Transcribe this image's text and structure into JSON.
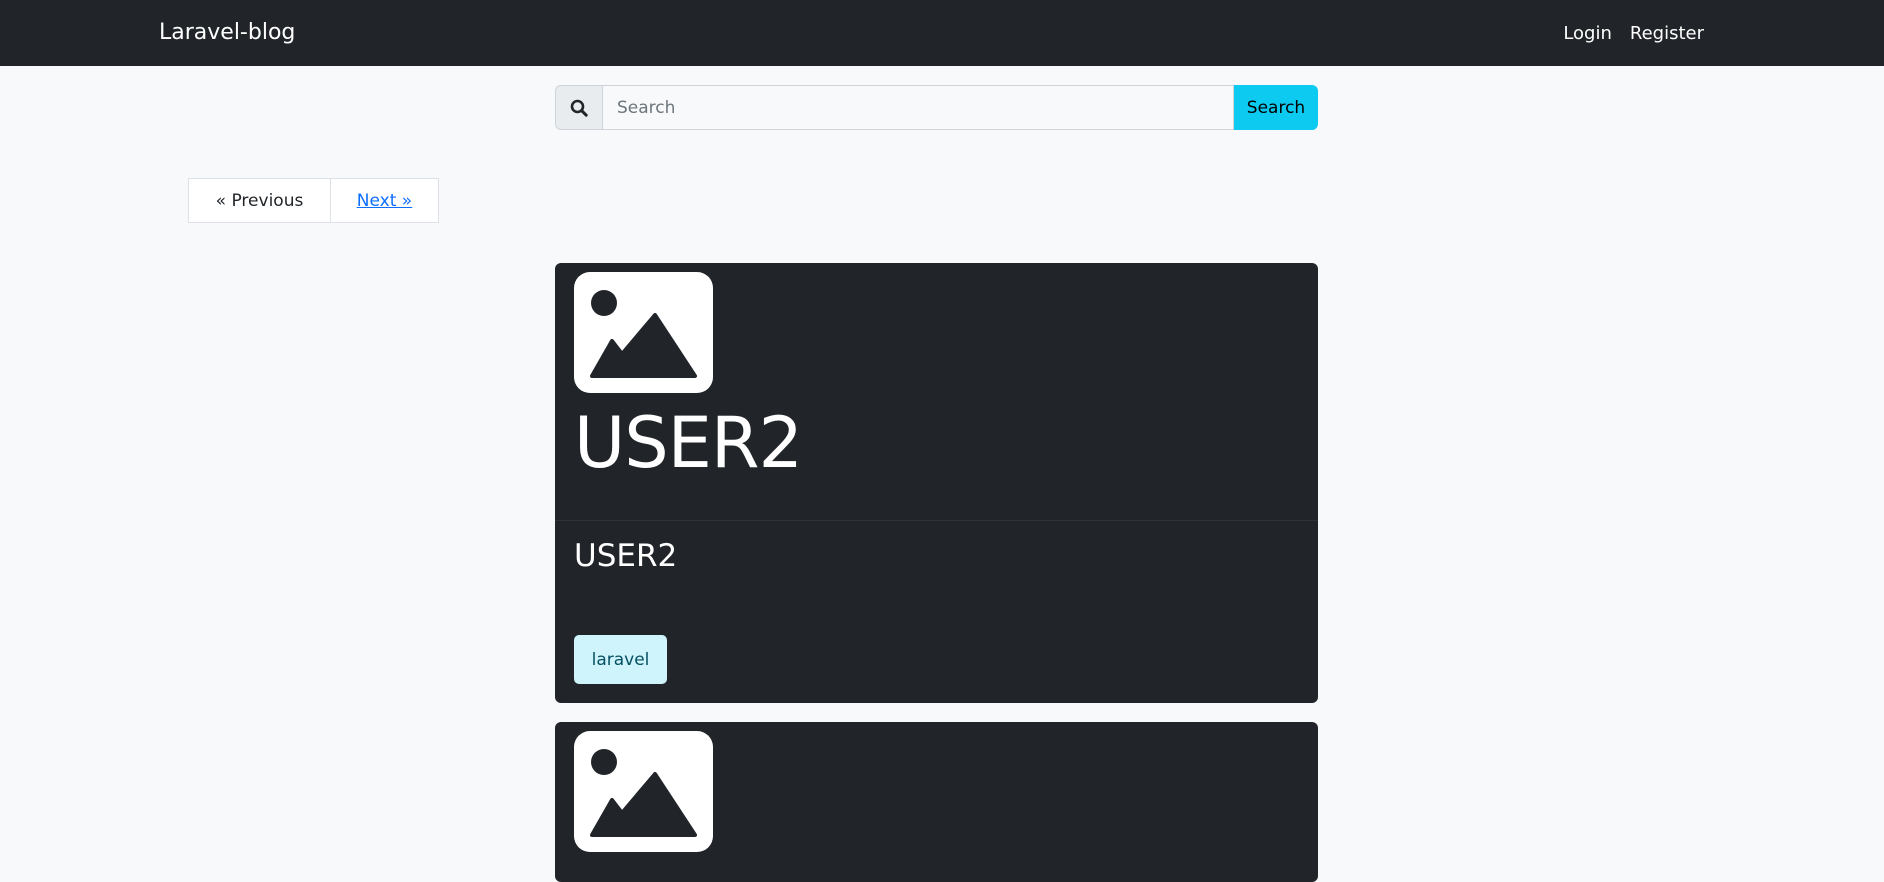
{
  "navbar": {
    "brand": "Laravel-blog",
    "links": [
      {
        "label": "Login"
      },
      {
        "label": "Register"
      }
    ]
  },
  "search": {
    "placeholder": "Search",
    "value": "",
    "button_label": "Search",
    "icon": "search-icon"
  },
  "pagination": {
    "previous_label": "« Previous",
    "next_label": "Next »"
  },
  "posts": [
    {
      "image_icon": "image-placeholder-icon",
      "title": "USER2",
      "subtitle": "USER2",
      "tag": "laravel"
    },
    {
      "image_icon": "image-placeholder-icon"
    }
  ],
  "colors": {
    "navbar_bg": "#212529",
    "page_bg": "#f8f9fa",
    "search_button": "#0dcaf0",
    "card_bg": "#212529",
    "badge_bg": "#cff4fc",
    "link": "#0d6efd"
  }
}
